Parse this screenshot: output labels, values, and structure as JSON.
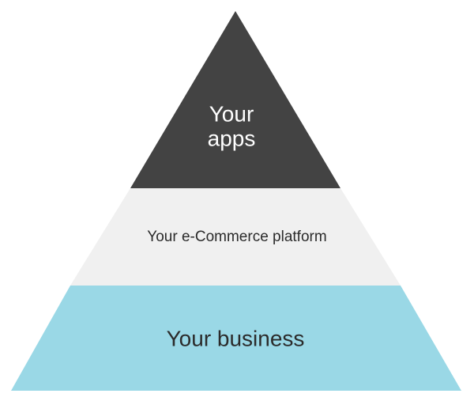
{
  "pyramid": {
    "tiers": [
      {
        "id": "apps",
        "lines": [
          "Your",
          "apps"
        ],
        "fill": "#434343",
        "text_color": "#ffffff"
      },
      {
        "id": "platform",
        "lines": [
          "Your e-Commerce platform"
        ],
        "fill": "#f0f0f0",
        "text_color": "#2b2b2b"
      },
      {
        "id": "business",
        "lines": [
          "Your business"
        ],
        "fill": "#9ad8e6",
        "text_color": "#2b2b2b"
      }
    ]
  }
}
